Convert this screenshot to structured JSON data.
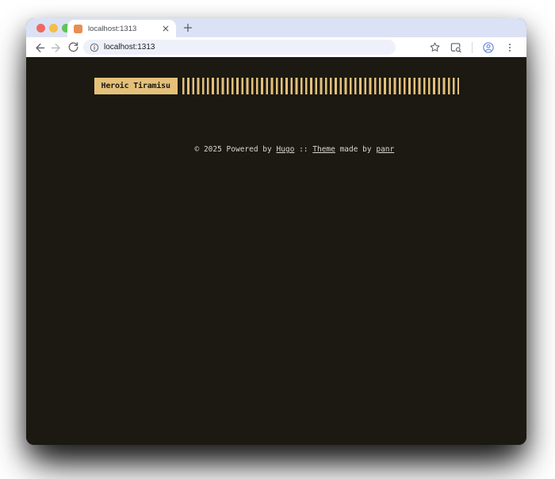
{
  "browser": {
    "tab": {
      "title": "localhost:1313"
    },
    "address_bar": {
      "url": "localhost:1313"
    },
    "icons": {
      "traffic_lights": [
        "close",
        "minimize",
        "zoom"
      ],
      "left": [
        "back-arrow",
        "forward-arrow",
        "reload"
      ],
      "url": [
        "info"
      ],
      "right": [
        "bookmark-star",
        "side-panel-search",
        "profile-avatar",
        "kebab-menu"
      ]
    }
  },
  "page": {
    "site_title": "Heroic Tiramisu",
    "footer": {
      "prefix": "© 2025 Powered by ",
      "hugo_link": "Hugo",
      "separator": " :: ",
      "theme_link": "Theme",
      "middle": " made by ",
      "author_link": "panr"
    }
  },
  "colors": {
    "accent": "#e4c07a",
    "page_background": "#1b1912",
    "footer_text": "#d9d6ce",
    "tab_strip": "#dce2f5",
    "favicon": "#e98d54",
    "traffic_red": "#ee6a5f",
    "traffic_yellow": "#f5bd4b",
    "traffic_green": "#61c355"
  }
}
